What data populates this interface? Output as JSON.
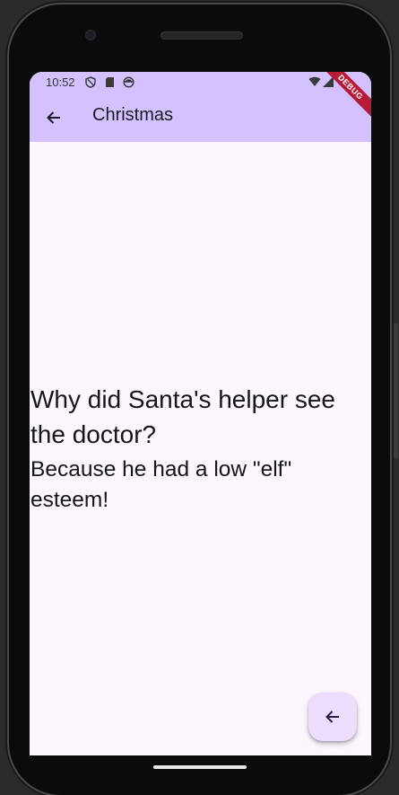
{
  "status_bar": {
    "time": "10:52",
    "icons": [
      "shield-icon",
      "sd-card-icon",
      "face-icon"
    ],
    "right_icons": [
      "wifi-icon",
      "signal-icon"
    ]
  },
  "debug_banner": "DEBUG",
  "app_bar": {
    "back_icon": "arrow-back-icon",
    "title": "Christmas",
    "color": "#d3c2ff"
  },
  "joke": {
    "question": "Why did Santa's helper see the doctor?",
    "answer": "Because he had a low \"elf\" esteem!"
  },
  "fab": {
    "icon": "arrow-back-icon",
    "color": "#ebddfb"
  },
  "colors": {
    "background": "#fdf6fe",
    "text": "#161519"
  }
}
